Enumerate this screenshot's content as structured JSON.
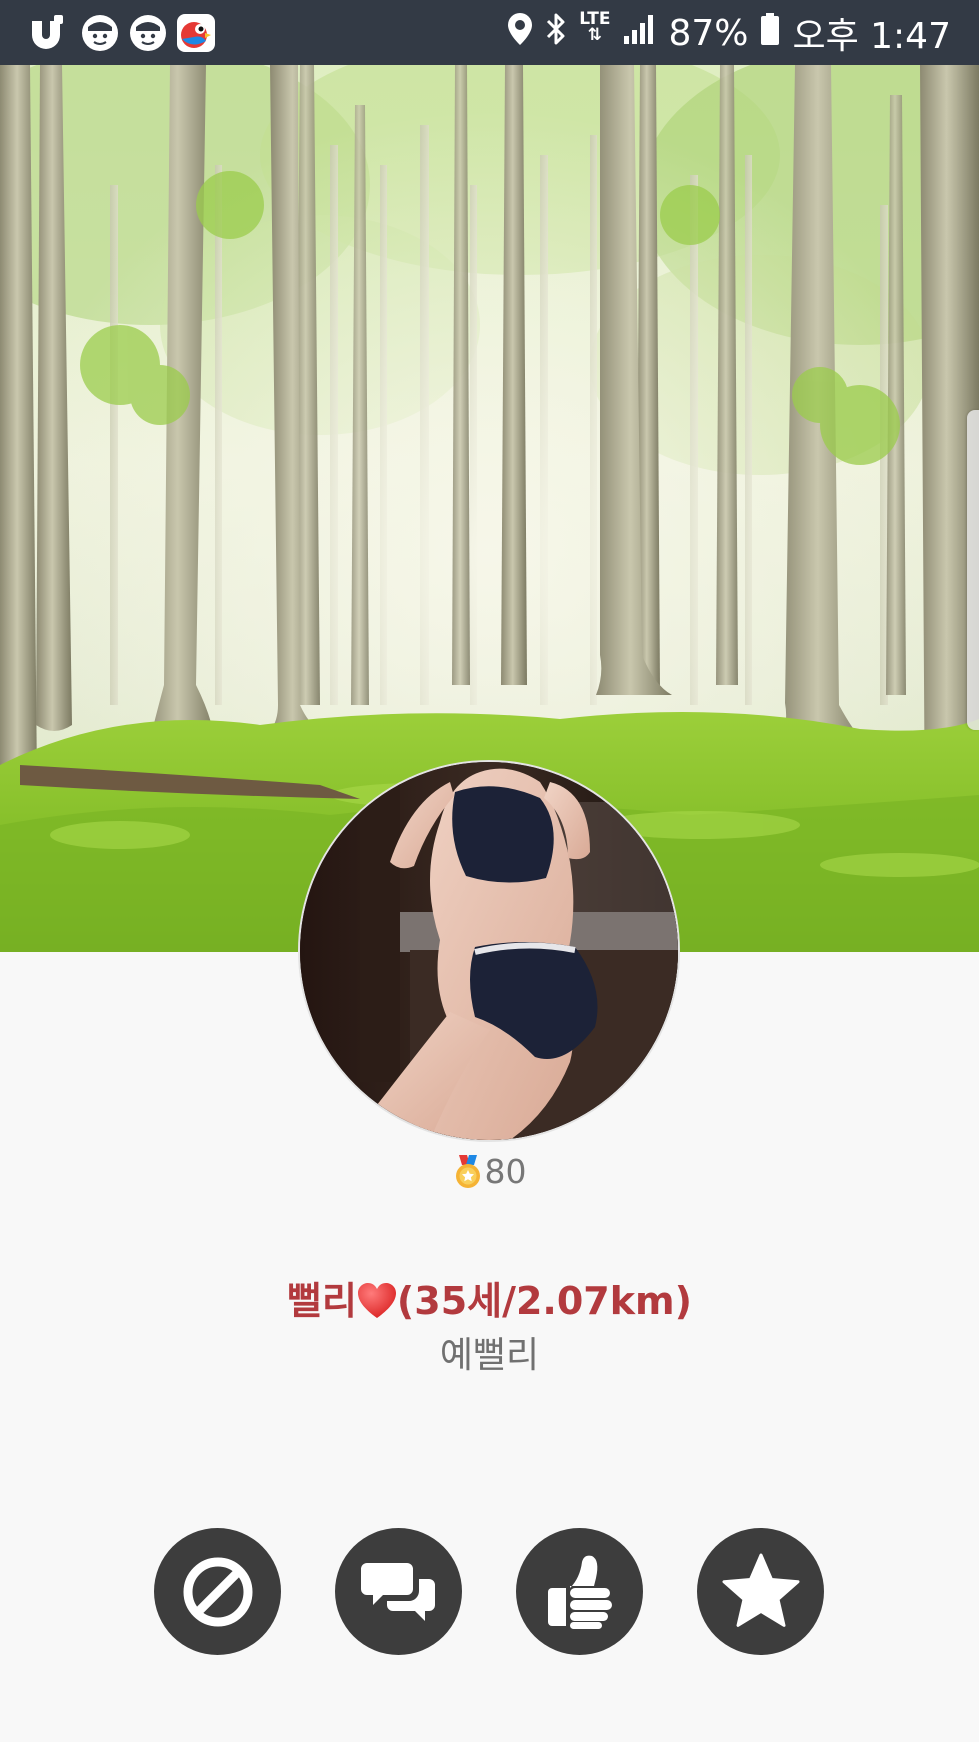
{
  "status_bar": {
    "battery": "87%",
    "time": "오후 1:47",
    "network": "LTE",
    "left_icons": [
      "u-plus-icon",
      "police-app-icon",
      "police-app-icon",
      "bird-app-icon"
    ],
    "right_icons": [
      "location-icon",
      "bluetooth-icon",
      "lte-icon",
      "signal-icon",
      "battery-icon"
    ]
  },
  "profile": {
    "score": "80",
    "name_prefix": "뻘리",
    "name_suffix": "(35세/2.07km)",
    "nickname": "예뻘리"
  },
  "actions": [
    {
      "name": "block",
      "icon": "block-icon"
    },
    {
      "name": "chat",
      "icon": "chat-bubbles-icon"
    },
    {
      "name": "like",
      "icon": "thumbs-up-icon"
    },
    {
      "name": "favorite",
      "icon": "star-icon"
    }
  ],
  "colors": {
    "status_bar": "#333a45",
    "name_red": "#b23a3e",
    "action_button": "#3d3d3d",
    "background": "#f8f8f8"
  }
}
